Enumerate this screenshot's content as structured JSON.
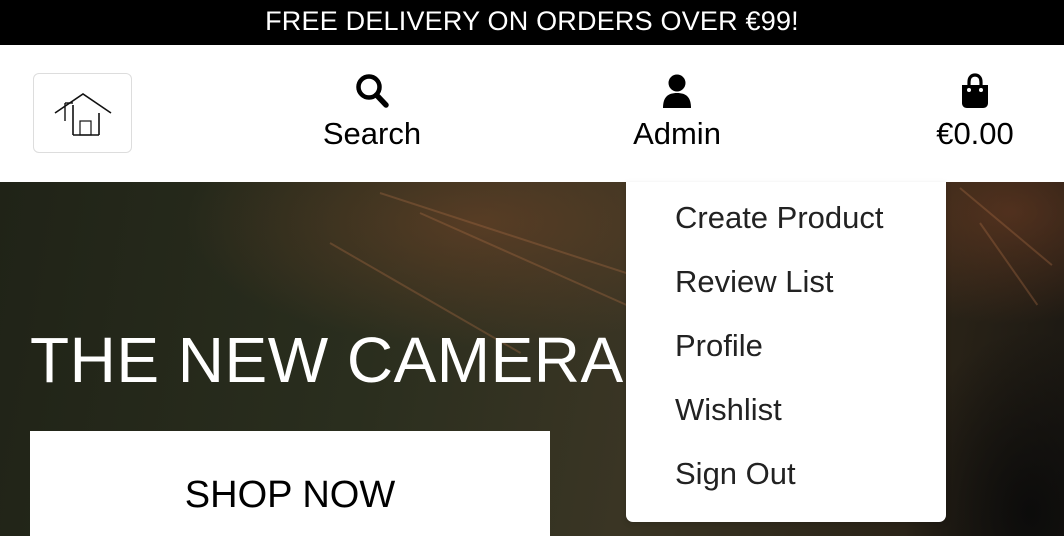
{
  "banner": {
    "text": "FREE DELIVERY ON ORDERS OVER €99!"
  },
  "header": {
    "logo_icon": "house-logo-icon",
    "nav": {
      "search": {
        "icon": "search-icon",
        "label": "Search"
      },
      "account": {
        "icon": "user-icon",
        "label": "Admin"
      },
      "cart": {
        "icon": "shopping-bag-icon",
        "total": "€0.00"
      }
    }
  },
  "account_menu": {
    "items": [
      {
        "label": "Create Product"
      },
      {
        "label": "Review List"
      },
      {
        "label": "Profile"
      },
      {
        "label": "Wishlist"
      },
      {
        "label": "Sign Out"
      }
    ]
  },
  "hero": {
    "title": "THE NEW CAMERAS",
    "cta_label": "SHOP NOW"
  },
  "colors": {
    "banner_bg": "#000000",
    "banner_text": "#ffffff",
    "hero_bg": "#2a2e1e",
    "cta_bg": "#ffffff",
    "menu_text": "#222222"
  }
}
